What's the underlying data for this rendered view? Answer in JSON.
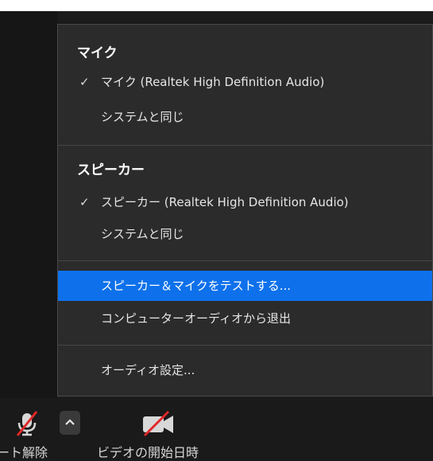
{
  "menu": {
    "mic_section_title": "マイク",
    "mic_items": [
      {
        "label": "マイク (Realtek High Definition Audio)",
        "checked": true
      },
      {
        "label": "システムと同じ",
        "checked": false
      }
    ],
    "speaker_section_title": "スピーカー",
    "speaker_items": [
      {
        "label": "スピーカー (Realtek High Definition Audio)",
        "checked": true
      },
      {
        "label": "システムと同じ",
        "checked": false
      }
    ],
    "actions": [
      {
        "label": "スピーカー＆マイクをテストする...",
        "highlighted": true
      },
      {
        "label": "コンピューターオーディオから退出",
        "highlighted": false
      }
    ],
    "settings_label": "オーディオ設定...",
    "check_glyph": "✓",
    "highlight_color": "#0e71eb"
  },
  "toolbar": {
    "unmute_label": "ート解除",
    "start_video_label": "ビデオの開始日時",
    "chevron_glyph": "^"
  }
}
